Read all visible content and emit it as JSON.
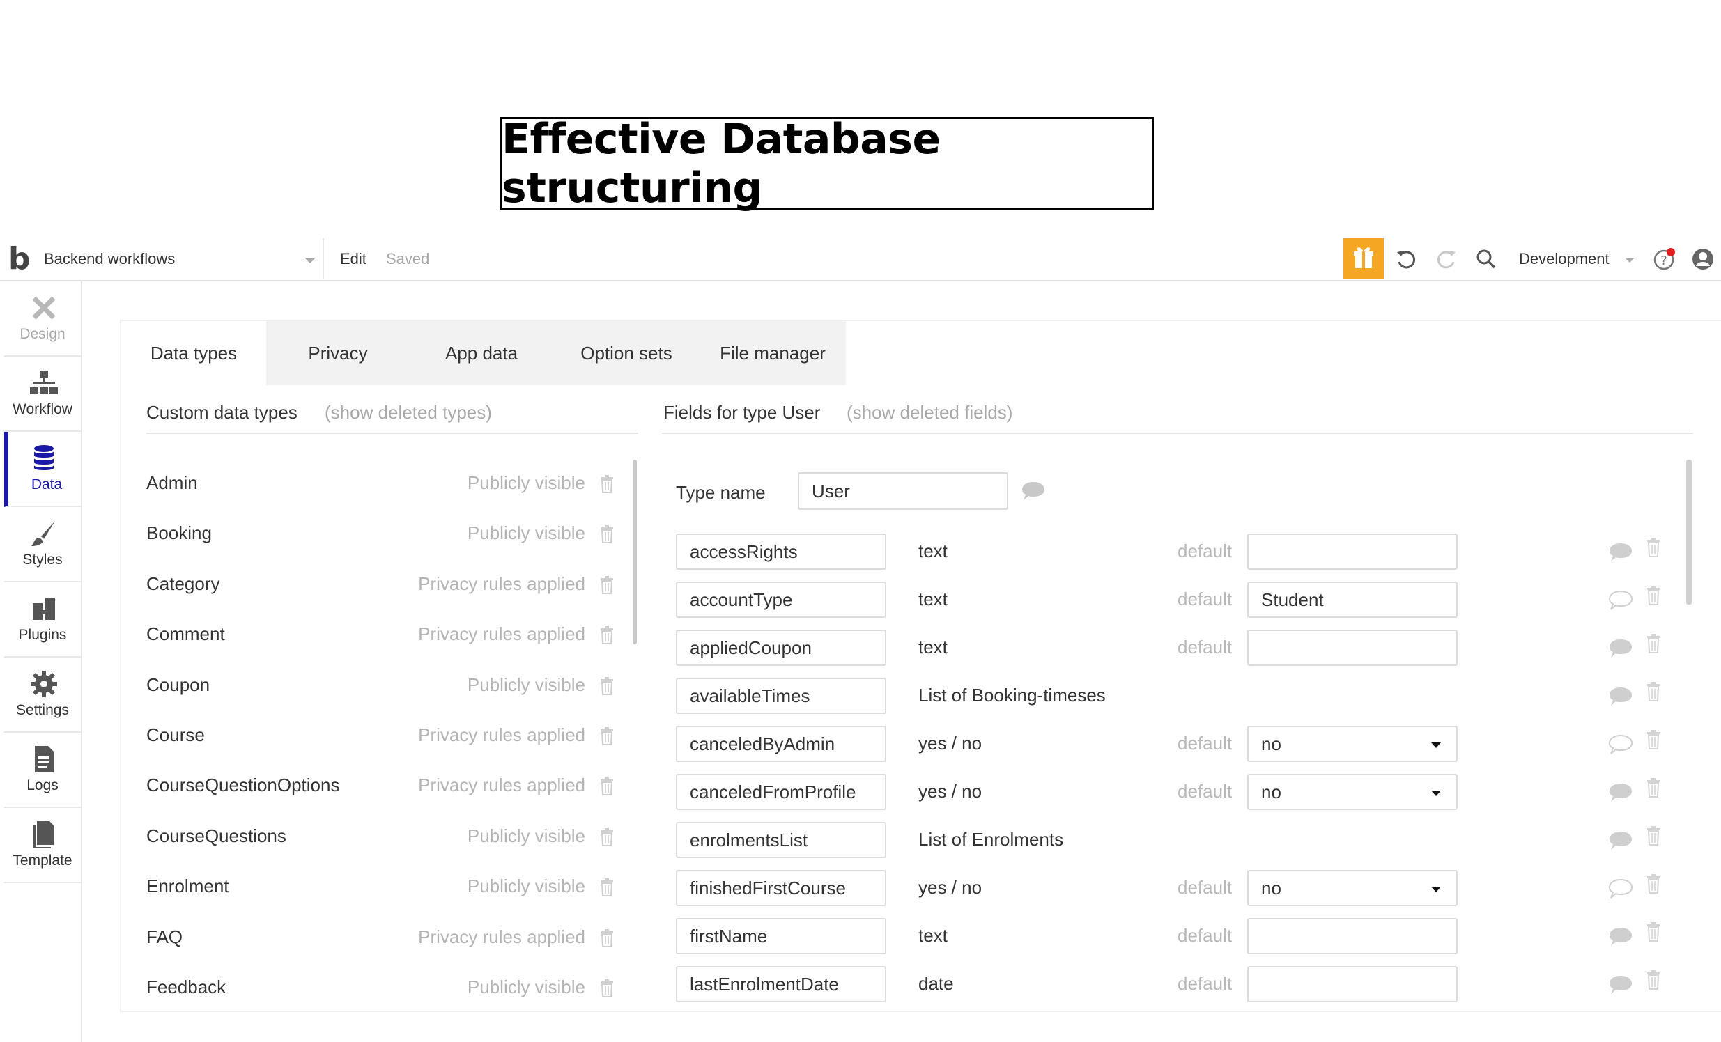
{
  "banner": {
    "title": "Effective Database structuring"
  },
  "topbar": {
    "logo": "b",
    "page_selector": "Backend workflows",
    "edit_label": "Edit",
    "saved_label": "Saved",
    "environment": "Development",
    "icons": [
      "gift-icon",
      "undo-icon",
      "redo-icon",
      "search-icon",
      "help-icon",
      "user-avatar-icon"
    ],
    "gift_color": "#f5a623"
  },
  "sidebar": {
    "items": [
      {
        "label": "Design",
        "icon": "design-icon"
      },
      {
        "label": "Workflow",
        "icon": "workflow-icon"
      },
      {
        "label": "Data",
        "icon": "database-icon",
        "active": true
      },
      {
        "label": "Styles",
        "icon": "brush-icon"
      },
      {
        "label": "Plugins",
        "icon": "plugins-icon"
      },
      {
        "label": "Settings",
        "icon": "gear-icon"
      },
      {
        "label": "Logs",
        "icon": "document-icon"
      },
      {
        "label": "Template",
        "icon": "template-icon"
      }
    ],
    "active_color": "#1a1aa6"
  },
  "tabs": [
    "Data types",
    "Privacy",
    "App data",
    "Option sets",
    "File manager"
  ],
  "custom_types": {
    "heading": "Custom data types",
    "show_deleted": "(show deleted types)",
    "items": [
      {
        "name": "Admin",
        "visibility": "Publicly visible"
      },
      {
        "name": "Booking",
        "visibility": "Publicly visible"
      },
      {
        "name": "Category",
        "visibility": "Privacy rules applied"
      },
      {
        "name": "Comment",
        "visibility": "Privacy rules applied"
      },
      {
        "name": "Coupon",
        "visibility": "Publicly visible"
      },
      {
        "name": "Course",
        "visibility": "Privacy rules applied"
      },
      {
        "name": "CourseQuestionOptions",
        "visibility": "Privacy rules applied"
      },
      {
        "name": "CourseQuestions",
        "visibility": "Publicly visible"
      },
      {
        "name": "Enrolment",
        "visibility": "Publicly visible"
      },
      {
        "name": "FAQ",
        "visibility": "Privacy rules applied"
      },
      {
        "name": "Feedback",
        "visibility": "Publicly visible"
      }
    ]
  },
  "fields_panel": {
    "heading": "Fields for type User",
    "show_deleted": "(show deleted fields)",
    "type_name_label": "Type name",
    "type_name_value": "User",
    "default_label": "default",
    "fields": [
      {
        "name": "accessRights",
        "type": "text",
        "has_default": true,
        "default": "",
        "dropdown": false
      },
      {
        "name": "accountType",
        "type": "text",
        "has_default": true,
        "default": "Student",
        "dropdown": false
      },
      {
        "name": "appliedCoupon",
        "type": "text",
        "has_default": true,
        "default": "",
        "dropdown": false
      },
      {
        "name": "availableTimes",
        "type": "List of Booking-timeses",
        "has_default": false,
        "default": "",
        "dropdown": false
      },
      {
        "name": "canceledByAdmin",
        "type": "yes / no",
        "has_default": true,
        "default": "no",
        "dropdown": true
      },
      {
        "name": "canceledFromProfile",
        "type": "yes / no",
        "has_default": true,
        "default": "no",
        "dropdown": true
      },
      {
        "name": "enrolmentsList",
        "type": "List of Enrolments",
        "has_default": false,
        "default": "",
        "dropdown": false
      },
      {
        "name": "finishedFirstCourse",
        "type": "yes / no",
        "has_default": true,
        "default": "no",
        "dropdown": true
      },
      {
        "name": "firstName",
        "type": "text",
        "has_default": true,
        "default": "",
        "dropdown": false
      },
      {
        "name": "lastEnrolmentDate",
        "type": "date",
        "has_default": true,
        "default": "",
        "dropdown": false
      }
    ]
  }
}
